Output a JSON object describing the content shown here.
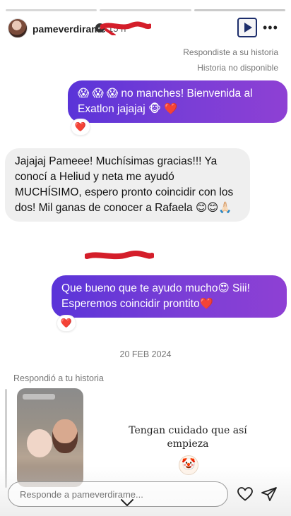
{
  "header": {
    "username": "pameverdirame",
    "time": "15 h",
    "more_icon": "•••"
  },
  "meta": {
    "replied_story": "Respondiste a su historia",
    "story_unavailable": "Historia no disponible"
  },
  "messages": [
    {
      "from": "me",
      "text": "😱 😱 😱  no manches! Bienvenida al Exatlon jajajaj 🐵 ❤️",
      "reaction": "❤️"
    },
    {
      "from": "them",
      "text": "Jajajaj Pameee! Muchísimas gracias!!! Ya conocí a Heliud y neta me ayudó MUCHÍSIMO, espero pronto coincidir con los dos! Mil ganas de conocer a Rafaela 😊😊🙏🏻"
    },
    {
      "from": "me",
      "text": "Que bueno que te ayudo mucho😍 Siii! Esperemos coincidir prontito❤️",
      "reaction": "❤️"
    }
  ],
  "date_divider": "20 FEB 2024",
  "replied_to_your_story": "Respondió a tu historia",
  "story_caption": "Tengan cuidado que así empieza",
  "story_emoji": "🤡",
  "footer": {
    "reply_placeholder": "Responde a pameverdirame..."
  },
  "colors": {
    "outgoing_bubble": "#6a3bd7",
    "incoming_bubble": "#efefef",
    "redaction_scribble": "#d41e2a",
    "play_border": "#1c2d6b"
  }
}
